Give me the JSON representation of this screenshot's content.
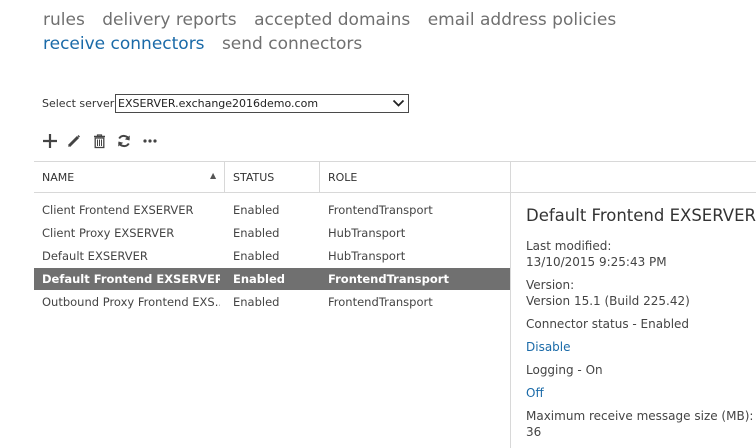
{
  "nav": {
    "tabs": [
      {
        "label": "rules",
        "active": false
      },
      {
        "label": "delivery reports",
        "active": false
      },
      {
        "label": "accepted domains",
        "active": false
      },
      {
        "label": "email address policies",
        "active": false
      },
      {
        "label": "receive connectors",
        "active": true
      },
      {
        "label": "send connectors",
        "active": false
      }
    ]
  },
  "server": {
    "label": "Select server:",
    "selected": "EXSERVER.exchange2016demo.com"
  },
  "toolbar": {
    "icons": [
      "add-icon",
      "edit-icon",
      "delete-icon",
      "refresh-icon",
      "more-icon"
    ]
  },
  "table": {
    "columns": [
      "NAME",
      "STATUS",
      "ROLE"
    ],
    "sort": {
      "column": "NAME",
      "direction": "ascending"
    },
    "rows": [
      {
        "name": "Client Frontend EXSERVER",
        "status": "Enabled",
        "role": "FrontendTransport",
        "selected": false
      },
      {
        "name": "Client Proxy EXSERVER",
        "status": "Enabled",
        "role": "HubTransport",
        "selected": false
      },
      {
        "name": "Default EXSERVER",
        "status": "Enabled",
        "role": "HubTransport",
        "selected": false
      },
      {
        "name": "Default Frontend EXSERVER",
        "status": "Enabled",
        "role": "FrontendTransport",
        "selected": true
      },
      {
        "name": "Outbound Proxy Frontend EXS...",
        "status": "Enabled",
        "role": "FrontendTransport",
        "selected": false
      }
    ]
  },
  "details": {
    "title": "Default Frontend EXSERVER",
    "last_modified_label": "Last modified:",
    "last_modified_value": "13/10/2015 9:25:43 PM",
    "version_label": "Version:",
    "version_value": "Version 15.1 (Build 225.42)",
    "connector_status": "Connector status - Enabled",
    "disable_link": "Disable",
    "logging": "Logging - On",
    "off_link": "Off",
    "max_size_label": "Maximum receive message size (MB):",
    "max_size_value": "36"
  },
  "colors": {
    "accent": "#1a6aa8",
    "selected_row": "#707070",
    "tab_inactive": "#707070"
  }
}
